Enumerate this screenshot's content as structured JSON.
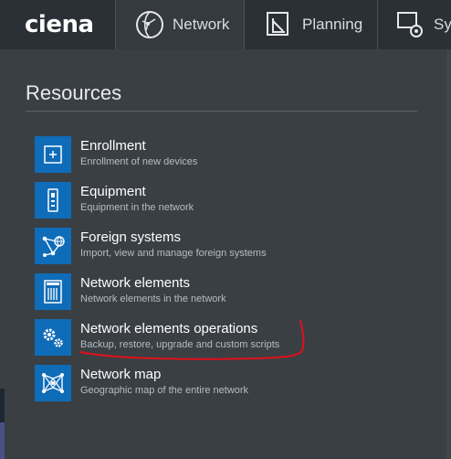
{
  "brand": {
    "logo_text": "ciena"
  },
  "tabs": [
    {
      "label": "Network",
      "icon": "network-icon",
      "active": true
    },
    {
      "label": "Planning",
      "icon": "planning-icon"
    },
    {
      "label": "Sys",
      "icon": "system-gear-icon"
    }
  ],
  "resources": {
    "title": "Resources",
    "items": [
      {
        "title": "Enrollment",
        "desc": "Enrollment of new devices",
        "icon": "plus-icon"
      },
      {
        "title": "Equipment",
        "desc": "Equipment in the network",
        "icon": "equipment-icon"
      },
      {
        "title": "Foreign systems",
        "desc": "Import, view and manage foreign systems",
        "icon": "foreign-systems-icon"
      },
      {
        "title": "Network elements",
        "desc": "Network elements in the network",
        "icon": "network-elements-icon"
      },
      {
        "title": "Network elements operations",
        "desc": "Backup, restore, upgrade and custom scripts",
        "icon": "gears-icon"
      },
      {
        "title": "Network map",
        "desc": "Geographic map of the entire network",
        "icon": "network-map-icon"
      }
    ]
  },
  "colors": {
    "topbar_bg": "#2b3036",
    "panel_bg": "#3a3f44",
    "accent_blue": "#0f6cb8",
    "annotation_red": "#e0101a"
  }
}
